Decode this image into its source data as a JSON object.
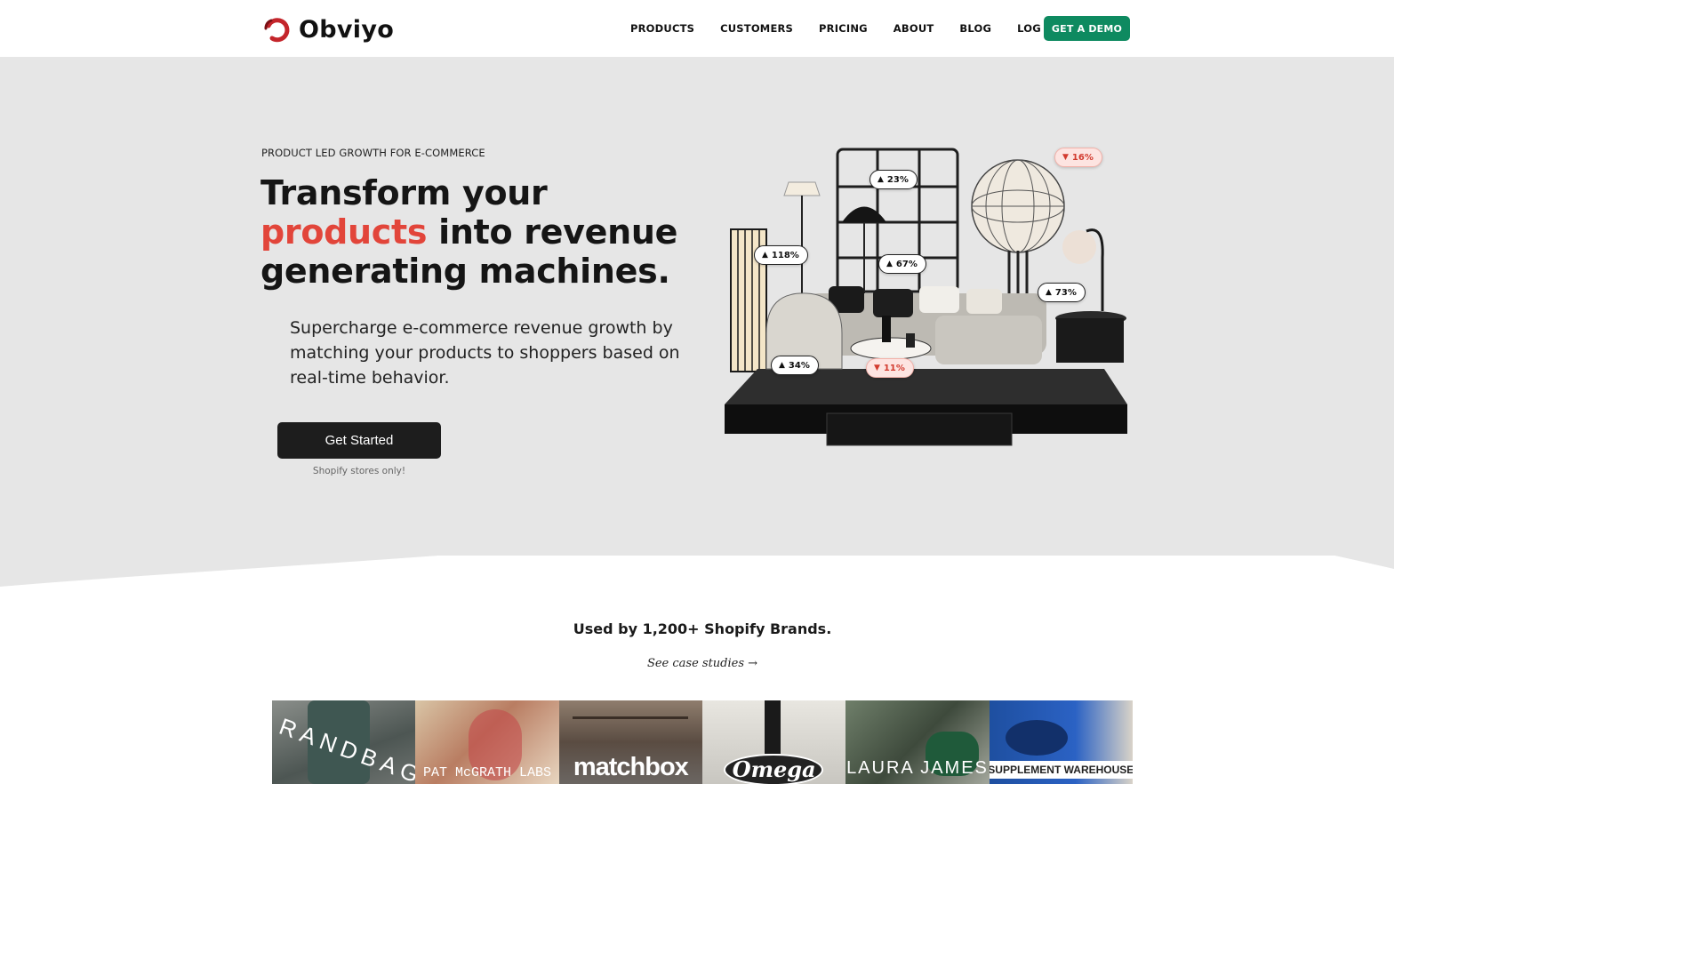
{
  "brand": {
    "name": "Obviyo"
  },
  "nav": {
    "links": [
      "PRODUCTS",
      "CUSTOMERS",
      "PRICING",
      "ABOUT",
      "BLOG",
      "LOG IN"
    ],
    "demo_label": "GET A DEMO"
  },
  "hero": {
    "eyebrow": "PRODUCT LED GROWTH FOR E-COMMERCE",
    "headline_line1": "Transform your",
    "headline_accent": "products",
    "headline_line2_rest": " into revenue",
    "headline_line3": "generating machines.",
    "subtext": "Supercharge e-commerce revenue growth by matching your products to shoppers based on real-time behavior.",
    "cta_label": "Get Started",
    "cta_note": "Shopify stores only!"
  },
  "badges": [
    {
      "label": "23%",
      "direction": "up"
    },
    {
      "label": "16%",
      "direction": "down"
    },
    {
      "label": "118%",
      "direction": "up"
    },
    {
      "label": "67%",
      "direction": "up"
    },
    {
      "label": "73%",
      "direction": "up"
    },
    {
      "label": "34%",
      "direction": "up"
    },
    {
      "label": "11%",
      "direction": "down"
    }
  ],
  "brands": {
    "title": "Used by 1,200+ Shopify Brands.",
    "case_link": "See case studies →",
    "logos": [
      "RANDBAG",
      "PAT McGRATH LABS",
      "matchbox",
      "Omega",
      "LAURA JAMES",
      "SUPPLEMENT WAREHOUSE"
    ]
  },
  "colors": {
    "accent_red": "#e2453a",
    "demo_green": "#0e8a60",
    "hero_bg": "#e6e6e6"
  }
}
